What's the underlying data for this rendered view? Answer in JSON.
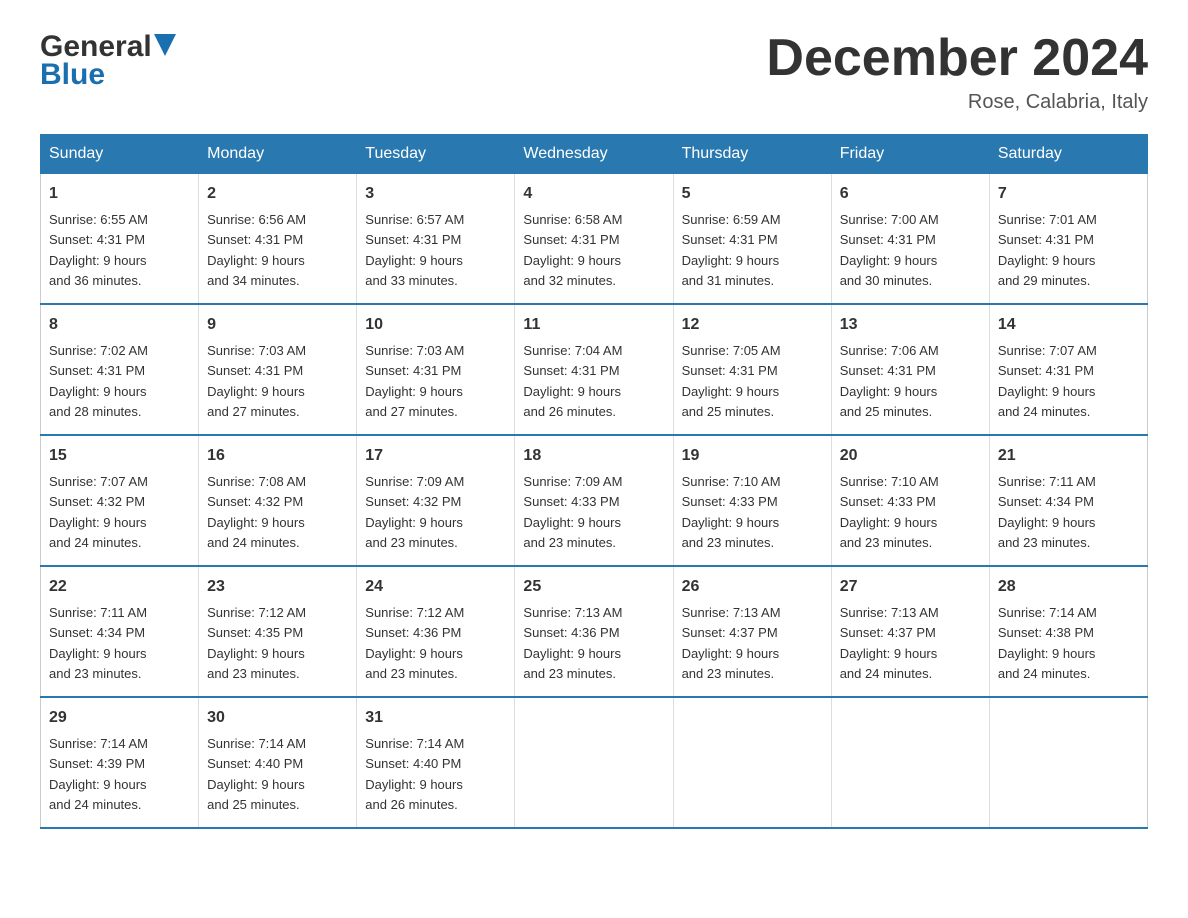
{
  "logo": {
    "name_part1": "General",
    "name_part2": "Blue"
  },
  "header": {
    "title": "December 2024",
    "location": "Rose, Calabria, Italy"
  },
  "days_of_week": [
    "Sunday",
    "Monday",
    "Tuesday",
    "Wednesday",
    "Thursday",
    "Friday",
    "Saturday"
  ],
  "weeks": [
    [
      {
        "day": "1",
        "sunrise": "6:55 AM",
        "sunset": "4:31 PM",
        "daylight": "9 hours and 36 minutes."
      },
      {
        "day": "2",
        "sunrise": "6:56 AM",
        "sunset": "4:31 PM",
        "daylight": "9 hours and 34 minutes."
      },
      {
        "day": "3",
        "sunrise": "6:57 AM",
        "sunset": "4:31 PM",
        "daylight": "9 hours and 33 minutes."
      },
      {
        "day": "4",
        "sunrise": "6:58 AM",
        "sunset": "4:31 PM",
        "daylight": "9 hours and 32 minutes."
      },
      {
        "day": "5",
        "sunrise": "6:59 AM",
        "sunset": "4:31 PM",
        "daylight": "9 hours and 31 minutes."
      },
      {
        "day": "6",
        "sunrise": "7:00 AM",
        "sunset": "4:31 PM",
        "daylight": "9 hours and 30 minutes."
      },
      {
        "day": "7",
        "sunrise": "7:01 AM",
        "sunset": "4:31 PM",
        "daylight": "9 hours and 29 minutes."
      }
    ],
    [
      {
        "day": "8",
        "sunrise": "7:02 AM",
        "sunset": "4:31 PM",
        "daylight": "9 hours and 28 minutes."
      },
      {
        "day": "9",
        "sunrise": "7:03 AM",
        "sunset": "4:31 PM",
        "daylight": "9 hours and 27 minutes."
      },
      {
        "day": "10",
        "sunrise": "7:03 AM",
        "sunset": "4:31 PM",
        "daylight": "9 hours and 27 minutes."
      },
      {
        "day": "11",
        "sunrise": "7:04 AM",
        "sunset": "4:31 PM",
        "daylight": "9 hours and 26 minutes."
      },
      {
        "day": "12",
        "sunrise": "7:05 AM",
        "sunset": "4:31 PM",
        "daylight": "9 hours and 25 minutes."
      },
      {
        "day": "13",
        "sunrise": "7:06 AM",
        "sunset": "4:31 PM",
        "daylight": "9 hours and 25 minutes."
      },
      {
        "day": "14",
        "sunrise": "7:07 AM",
        "sunset": "4:31 PM",
        "daylight": "9 hours and 24 minutes."
      }
    ],
    [
      {
        "day": "15",
        "sunrise": "7:07 AM",
        "sunset": "4:32 PM",
        "daylight": "9 hours and 24 minutes."
      },
      {
        "day": "16",
        "sunrise": "7:08 AM",
        "sunset": "4:32 PM",
        "daylight": "9 hours and 24 minutes."
      },
      {
        "day": "17",
        "sunrise": "7:09 AM",
        "sunset": "4:32 PM",
        "daylight": "9 hours and 23 minutes."
      },
      {
        "day": "18",
        "sunrise": "7:09 AM",
        "sunset": "4:33 PM",
        "daylight": "9 hours and 23 minutes."
      },
      {
        "day": "19",
        "sunrise": "7:10 AM",
        "sunset": "4:33 PM",
        "daylight": "9 hours and 23 minutes."
      },
      {
        "day": "20",
        "sunrise": "7:10 AM",
        "sunset": "4:33 PM",
        "daylight": "9 hours and 23 minutes."
      },
      {
        "day": "21",
        "sunrise": "7:11 AM",
        "sunset": "4:34 PM",
        "daylight": "9 hours and 23 minutes."
      }
    ],
    [
      {
        "day": "22",
        "sunrise": "7:11 AM",
        "sunset": "4:34 PM",
        "daylight": "9 hours and 23 minutes."
      },
      {
        "day": "23",
        "sunrise": "7:12 AM",
        "sunset": "4:35 PM",
        "daylight": "9 hours and 23 minutes."
      },
      {
        "day": "24",
        "sunrise": "7:12 AM",
        "sunset": "4:36 PM",
        "daylight": "9 hours and 23 minutes."
      },
      {
        "day": "25",
        "sunrise": "7:13 AM",
        "sunset": "4:36 PM",
        "daylight": "9 hours and 23 minutes."
      },
      {
        "day": "26",
        "sunrise": "7:13 AM",
        "sunset": "4:37 PM",
        "daylight": "9 hours and 23 minutes."
      },
      {
        "day": "27",
        "sunrise": "7:13 AM",
        "sunset": "4:37 PM",
        "daylight": "9 hours and 24 minutes."
      },
      {
        "day": "28",
        "sunrise": "7:14 AM",
        "sunset": "4:38 PM",
        "daylight": "9 hours and 24 minutes."
      }
    ],
    [
      {
        "day": "29",
        "sunrise": "7:14 AM",
        "sunset": "4:39 PM",
        "daylight": "9 hours and 24 minutes."
      },
      {
        "day": "30",
        "sunrise": "7:14 AM",
        "sunset": "4:40 PM",
        "daylight": "9 hours and 25 minutes."
      },
      {
        "day": "31",
        "sunrise": "7:14 AM",
        "sunset": "4:40 PM",
        "daylight": "9 hours and 26 minutes."
      },
      null,
      null,
      null,
      null
    ]
  ],
  "labels": {
    "sunrise": "Sunrise:",
    "sunset": "Sunset:",
    "daylight": "Daylight:"
  }
}
